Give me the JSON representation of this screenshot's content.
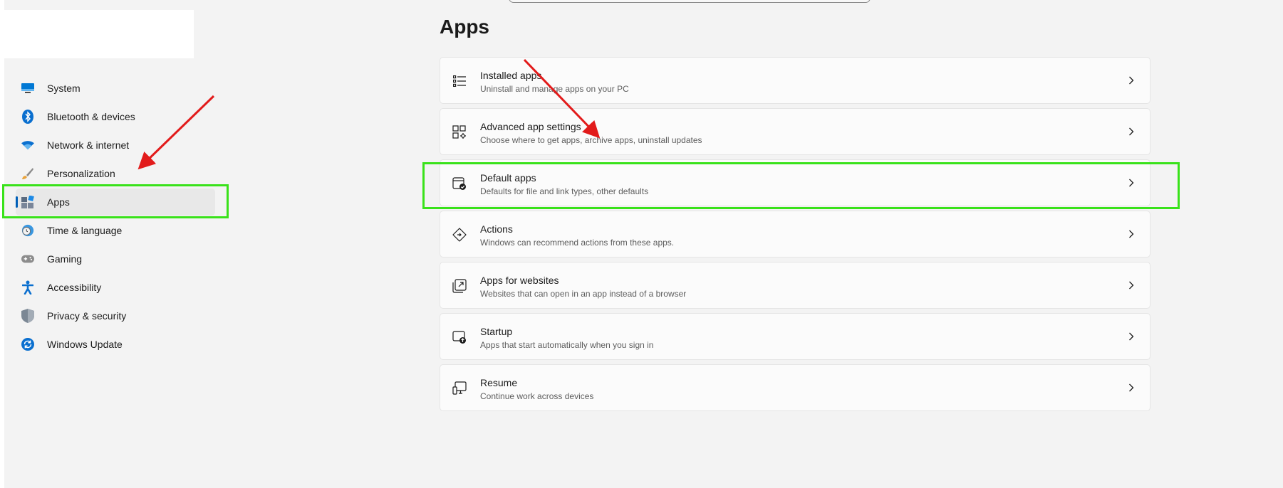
{
  "sidebar": {
    "items": [
      {
        "label": "System",
        "icon": "monitor-icon"
      },
      {
        "label": "Bluetooth & devices",
        "icon": "bluetooth-icon"
      },
      {
        "label": "Network & internet",
        "icon": "wifi-icon"
      },
      {
        "label": "Personalization",
        "icon": "brush-icon"
      },
      {
        "label": "Apps",
        "icon": "apps-icon",
        "selected": true
      },
      {
        "label": "Time & language",
        "icon": "clock-globe-icon"
      },
      {
        "label": "Gaming",
        "icon": "gamepad-icon"
      },
      {
        "label": "Accessibility",
        "icon": "accessibility-icon"
      },
      {
        "label": "Privacy & security",
        "icon": "shield-icon"
      },
      {
        "label": "Windows Update",
        "icon": "update-icon"
      }
    ]
  },
  "main": {
    "title": "Apps",
    "cards": [
      {
        "title": "Installed apps",
        "subtitle": "Uninstall and manage apps on your PC",
        "icon": "list-icon"
      },
      {
        "title": "Advanced app settings",
        "subtitle": "Choose where to get apps, archive apps, uninstall updates",
        "icon": "app-settings-icon"
      },
      {
        "title": "Default apps",
        "subtitle": "Defaults for file and link types, other defaults",
        "icon": "default-apps-icon"
      },
      {
        "title": "Actions",
        "subtitle": "Windows can recommend actions from these apps.",
        "icon": "actions-icon"
      },
      {
        "title": "Apps for websites",
        "subtitle": "Websites that can open in an app instead of a browser",
        "icon": "open-in-app-icon"
      },
      {
        "title": "Startup",
        "subtitle": "Apps that start automatically when you sign in",
        "icon": "startup-icon"
      },
      {
        "title": "Resume",
        "subtitle": "Continue work across devices",
        "icon": "resume-icon"
      }
    ]
  },
  "colors": {
    "accent": "#005fb8",
    "highlight": "#39e21a",
    "arrow": "#e21b1b"
  }
}
